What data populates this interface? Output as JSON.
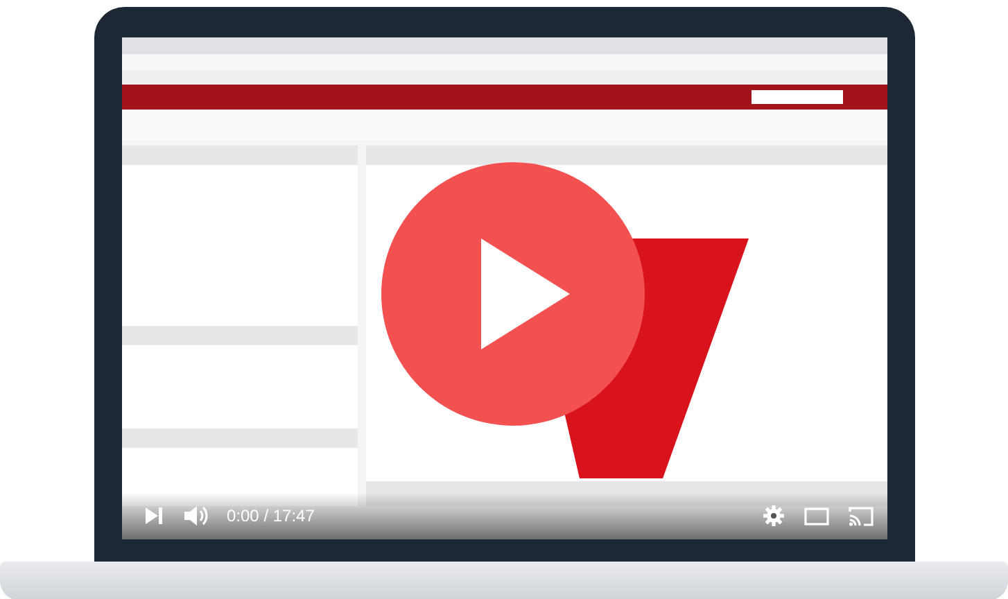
{
  "video_player": {
    "time": "0:00 / 17:47"
  }
}
